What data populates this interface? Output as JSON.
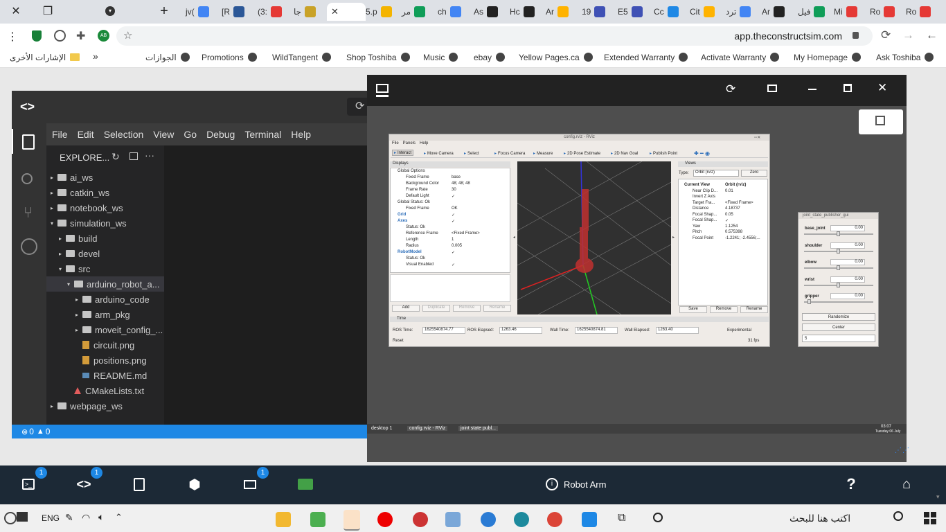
{
  "browser": {
    "tabs": [
      "jv(",
      "[R",
      "(3:",
      "جا",
      "",
      "5.p",
      "مر",
      "ch",
      "As",
      "Hc",
      "Ar",
      "19",
      "E5",
      "Cc",
      "Cit",
      "ترد",
      "Ar",
      "فيل",
      "Mi",
      "Ro",
      "Ro"
    ],
    "url": "app.theconstructsim.com",
    "bookmarks": [
      "Ask Toshiba",
      "My Homepage",
      "Activate Warranty",
      "Extended Warranty",
      "Yellow Pages.ca",
      "ebay",
      "Music",
      "Shop Toshiba",
      "WildTangent",
      "Promotions",
      "الجوازات"
    ],
    "other_bookmarks": "الإشارات الأخرى",
    "overflow": "»"
  },
  "ide": {
    "menu": [
      "File",
      "Edit",
      "Selection",
      "View",
      "Go",
      "Debug",
      "Terminal",
      "Help"
    ],
    "explorer_title": "EXPLORE...",
    "tree": [
      {
        "label": "ai_ws",
        "indent": 0,
        "arrow": "▸",
        "kind": "folder"
      },
      {
        "label": "catkin_ws",
        "indent": 0,
        "arrow": "▸",
        "kind": "folder"
      },
      {
        "label": "notebook_ws",
        "indent": 0,
        "arrow": "▸",
        "kind": "folder"
      },
      {
        "label": "simulation_ws",
        "indent": 0,
        "arrow": "▾",
        "kind": "folder"
      },
      {
        "label": "build",
        "indent": 1,
        "arrow": "▸",
        "kind": "folder"
      },
      {
        "label": "devel",
        "indent": 1,
        "arrow": "▸",
        "kind": "folder"
      },
      {
        "label": "src",
        "indent": 1,
        "arrow": "▾",
        "kind": "folder"
      },
      {
        "label": "arduino_robot_a...",
        "indent": 2,
        "arrow": "▾",
        "kind": "folder",
        "selected": true
      },
      {
        "label": "arduino_code",
        "indent": 3,
        "arrow": "▸",
        "kind": "folder"
      },
      {
        "label": "arm_pkg",
        "indent": 3,
        "arrow": "▸",
        "kind": "folder"
      },
      {
        "label": "moveit_config_...",
        "indent": 3,
        "arrow": "▸",
        "kind": "folder"
      },
      {
        "label": "circuit.png",
        "indent": 3,
        "arrow": "",
        "kind": "image"
      },
      {
        "label": "positions.png",
        "indent": 3,
        "arrow": "",
        "kind": "image"
      },
      {
        "label": "README.md",
        "indent": 3,
        "arrow": "",
        "kind": "md"
      },
      {
        "label": "CMakeLists.txt",
        "indent": 2,
        "arrow": "",
        "kind": "cmake"
      },
      {
        "label": "webpage_ws",
        "indent": 0,
        "arrow": "▸",
        "kind": "folder"
      }
    ],
    "status": {
      "errors": "0",
      "warnings": "0"
    }
  },
  "rviz": {
    "title": "config.rviz - RViz",
    "menu": [
      "File",
      "Panels",
      "Help"
    ],
    "tools": [
      "Interact",
      "Move Camera",
      "Select",
      "Focus Camera",
      "Measure",
      "2D Pose Estimate",
      "2D Nav Goal",
      "Publish Point"
    ],
    "displays_title": "Displays",
    "displays": [
      [
        "Global Options",
        ""
      ],
      [
        "Fixed Frame",
        "base"
      ],
      [
        "Background Color",
        "48; 48; 48"
      ],
      [
        "Frame Rate",
        "30"
      ],
      [
        "Default Light",
        "✓"
      ],
      [
        "Global Status: Ok",
        ""
      ],
      [
        "Fixed Frame",
        "OK"
      ],
      [
        "Grid",
        "✓"
      ],
      [
        "Axes",
        "✓"
      ],
      [
        "Status: Ok",
        ""
      ],
      [
        "Reference Frame",
        "<Fixed Frame>"
      ],
      [
        "Length",
        "1"
      ],
      [
        "Radius",
        "0.005"
      ],
      [
        "RobotModel",
        "✓"
      ],
      [
        "Status: Ok",
        ""
      ],
      [
        "Visual Enabled",
        "✓"
      ]
    ],
    "display_buttons": [
      "Add",
      "Duplicate",
      "Remove",
      "Rename"
    ],
    "views_title": "Views",
    "views_type_label": "Type:",
    "views_type": "Orbit (rviz)",
    "views_zero": "Zero",
    "views": [
      [
        "Current View",
        "Orbit (rviz)"
      ],
      [
        "Near Clip D...",
        "0.01"
      ],
      [
        "Invert Z Axis",
        ""
      ],
      [
        "Target Fra...",
        "<Fixed Frame>"
      ],
      [
        "Distance",
        "4.18737"
      ],
      [
        "Focal Shap...",
        "0.05"
      ],
      [
        "Focal Shap...",
        "✓"
      ],
      [
        "Yaw",
        "1.1254"
      ],
      [
        "Pitch",
        "0.575398"
      ],
      [
        "Focal Point",
        "-1.2241; -2.4556;..."
      ]
    ],
    "views_buttons": [
      "Save",
      "Remove",
      "Rename"
    ],
    "time_title": "Time",
    "time": {
      "ros_time_label": "ROS Time:",
      "ros_time": "1625540874.77",
      "ros_elapsed_label": "ROS Elapsed:",
      "ros_elapsed": "1263.46",
      "wall_time_label": "Wall Time:",
      "wall_time": "1625540874.81",
      "wall_elapsed_label": "Wall Elapsed:",
      "wall_elapsed": "1263.40",
      "experimental": "Experimental"
    },
    "reset": "Reset",
    "fps": "31 fps"
  },
  "joint_gui": {
    "title": "joint_state_publisher_gui",
    "joints": [
      {
        "name": "base_joint",
        "value": "0.00",
        "position": 0.5
      },
      {
        "name": "shoulder",
        "value": "0.00",
        "position": 0.5
      },
      {
        "name": "elbow",
        "value": "0.00",
        "position": 0.5
      },
      {
        "name": "wrist",
        "value": "0.00",
        "position": 0.5
      },
      {
        "name": "gripper",
        "value": "0.00",
        "position": 0.05
      }
    ],
    "randomize": "Randomize",
    "center": "Center",
    "spin": "5"
  },
  "desktop_taskbar": {
    "items": [
      "desktop 1",
      "config.rviz - RViz",
      "joint state publ..."
    ],
    "time": "03:07",
    "date": "Tuesday 06 July"
  },
  "dock": {
    "title": "Robot Arm",
    "badges": [
      "1",
      "1",
      "1"
    ]
  },
  "win_taskbar": {
    "search_placeholder": "اكتب هنا للبحث",
    "lang": "ENG"
  },
  "colors": {
    "dock_bg": "#1c2936",
    "ide_bg": "#252526",
    "status_bar": "#1e88e5",
    "vnc_bg": "#4e4e4e"
  }
}
